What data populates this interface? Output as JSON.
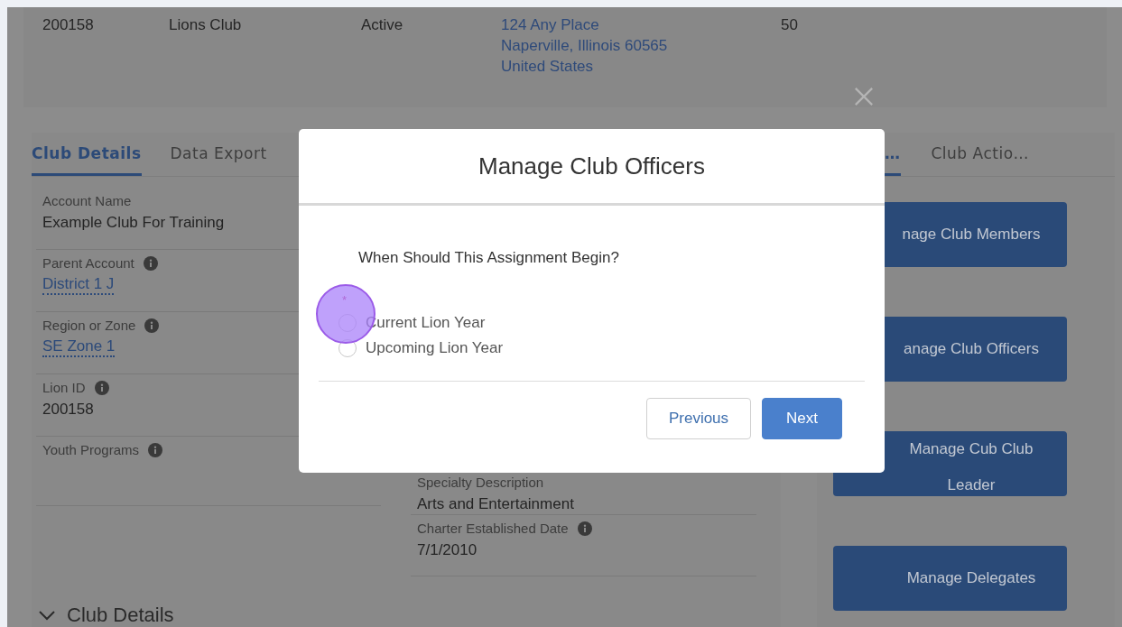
{
  "header": [
    {
      "kind": "text",
      "lines": [
        "200158"
      ]
    },
    {
      "kind": "text",
      "lines": [
        "Lions Club"
      ]
    },
    {
      "kind": "text",
      "lines": [
        "Active"
      ]
    },
    {
      "kind": "link",
      "lines": [
        "124 Any Place",
        "Naperville, Illinois 60565",
        "United States"
      ]
    },
    {
      "kind": "text",
      "lines": [
        "50"
      ]
    }
  ],
  "tabs": [
    {
      "label": "Club Details",
      "selected": true
    },
    {
      "label": "Data Export",
      "selected": false
    }
  ],
  "fields_left": [
    {
      "label": "Account Name",
      "info": false,
      "kind": "text",
      "value": "Example Club For Training"
    },
    {
      "label": "Parent Account",
      "info": true,
      "kind": "link",
      "value": "District 1 J"
    },
    {
      "label": "Region or Zone",
      "info": true,
      "kind": "link",
      "value": "SE Zone 1"
    },
    {
      "label": "Lion ID",
      "info": true,
      "kind": "text",
      "value": "200158"
    },
    {
      "label": "Youth Programs",
      "info": true,
      "kind": "empty"
    }
  ],
  "fields_right": [
    {
      "label": "Specialty Description",
      "info": false,
      "kind": "text",
      "value": "Arts and Entertainment"
    },
    {
      "label": "Charter Established Date",
      "info": true,
      "kind": "text",
      "value": "7/1/2010"
    }
  ],
  "side_tabs": [
    {
      "label": "…",
      "selected": true
    },
    {
      "label": "Club Actio…",
      "selected": false
    }
  ],
  "side_buttons": [
    "nage Club Members",
    "anage Club Officers",
    "Manage Cub Club Leader",
    "Manage Delegates"
  ],
  "section": {
    "title": "Club Details",
    "expanded": true
  },
  "modal": {
    "title": "Manage Club Officers",
    "question": "When Should This Assignment Begin?",
    "required_mark": "*",
    "options": [
      {
        "label": "Current Lion Year",
        "selected": false
      },
      {
        "label": "Upcoming Lion Year",
        "selected": false
      }
    ],
    "buttons": [
      {
        "label": "Previous",
        "kind": "neutral"
      },
      {
        "label": "Next",
        "kind": "brand"
      }
    ]
  }
}
